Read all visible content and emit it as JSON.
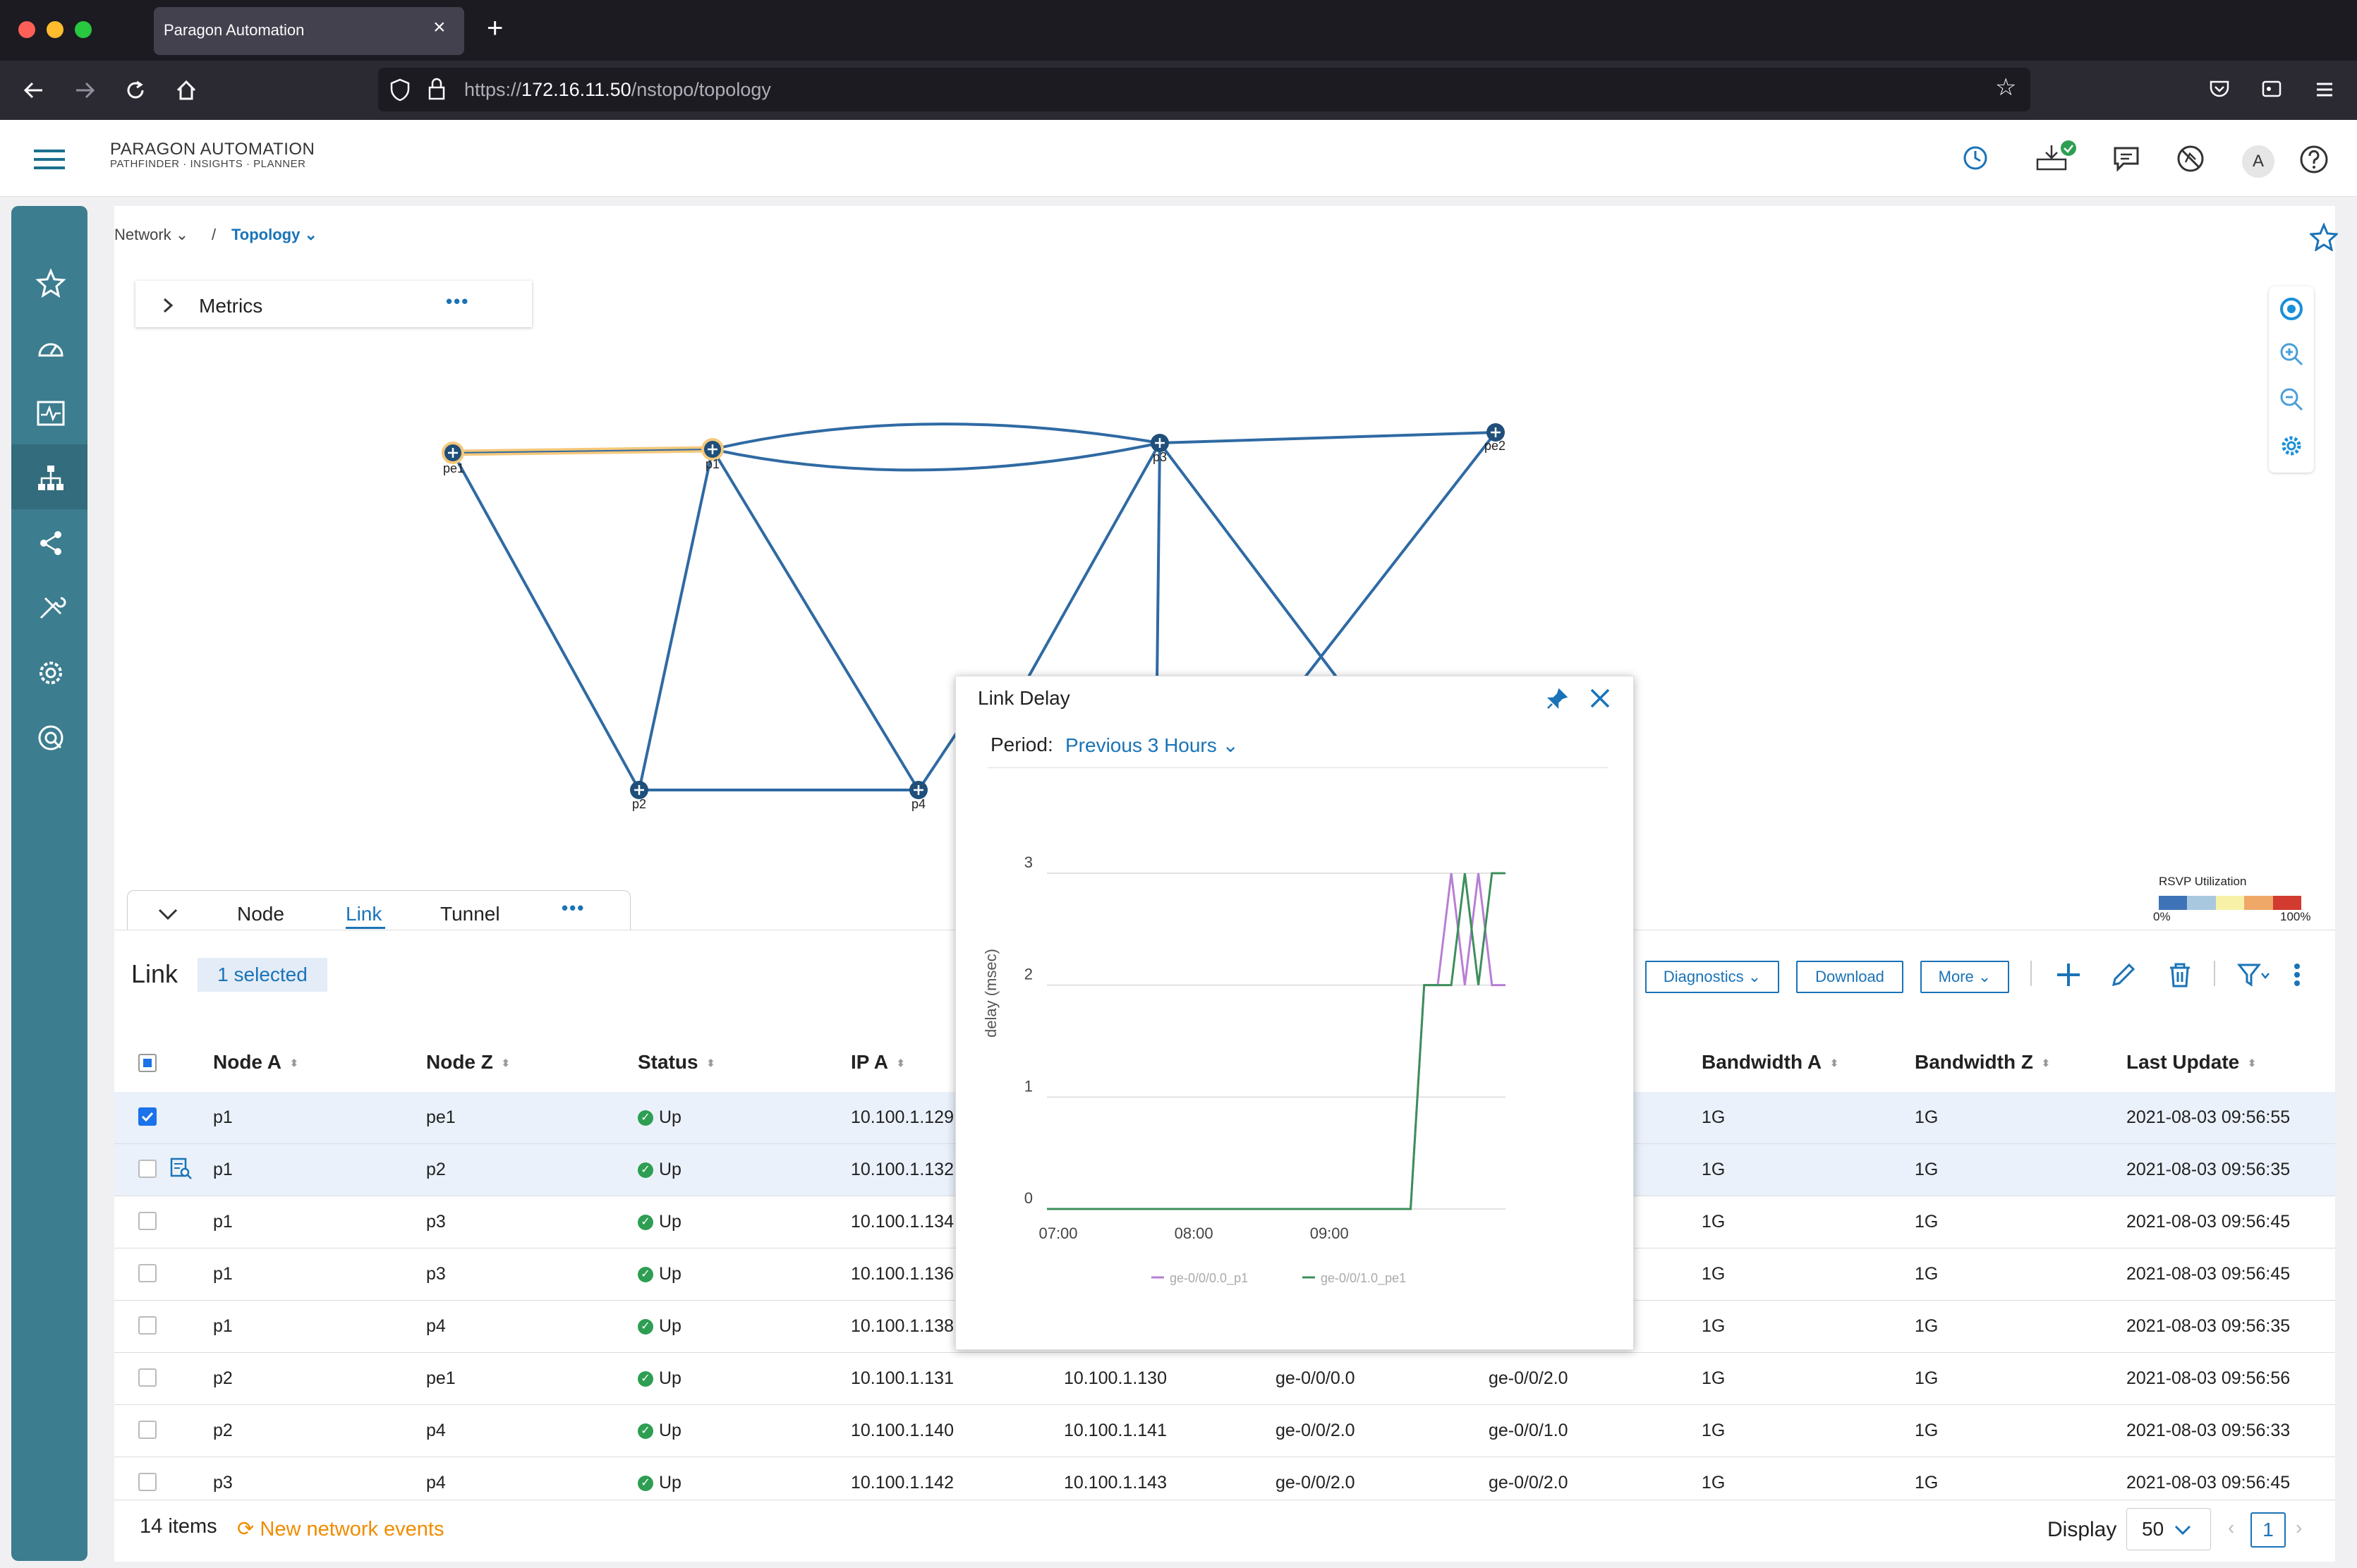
{
  "browser": {
    "tab_title": "Paragon Automation",
    "new_tab": "+",
    "close_tab": "×",
    "url_prefix": "https://",
    "url_host": "172.16.11.50",
    "url_path": "/nstopo/topology"
  },
  "app": {
    "brand_title": "PARAGON AUTOMATION",
    "brand_subtitle": "PATHFINDER · INSIGHTS · PLANNER",
    "avatar_letter": "A"
  },
  "breadcrumb": {
    "network": "Network",
    "separator": "/",
    "topology": "Topology"
  },
  "metrics": {
    "label": "Metrics",
    "more": "•••"
  },
  "topology": {
    "nodes": [
      {
        "id": "pe1",
        "label": "pe1",
        "selected": true
      },
      {
        "id": "p1",
        "label": "p1",
        "selected": true
      },
      {
        "id": "p3",
        "label": "p3",
        "selected": false
      },
      {
        "id": "pe2",
        "label": "pe2",
        "selected": false
      },
      {
        "id": "p2",
        "label": "p2",
        "selected": false
      },
      {
        "id": "p4",
        "label": "p4",
        "selected": false
      }
    ],
    "highlight_color": "#f5c87a",
    "link_color": "#2f6aa3"
  },
  "legend": {
    "title": "RSVP Utilization",
    "min": "0%",
    "max": "100%",
    "colors": [
      "#3e73b7",
      "#a8c8e0",
      "#f7f1a8",
      "#f0a868",
      "#d23b2f"
    ]
  },
  "bottom_tabs": {
    "node": "Node",
    "link": "Link",
    "tunnel": "Tunnel",
    "more": "•••",
    "active": "Link"
  },
  "table": {
    "title": "Link",
    "selected_chip": "1 selected",
    "buttons": {
      "diagnostics": "Diagnostics",
      "download": "Download",
      "more": "More"
    },
    "columns": [
      "Node A",
      "Node Z",
      "Status",
      "IP A",
      "",
      "",
      "",
      "Bandwidth A",
      "Bandwidth Z",
      "Last Update"
    ],
    "rows": [
      {
        "node_a": "p1",
        "node_z": "pe1",
        "status": "Up",
        "ip_a": "10.100.1.129",
        "ip_z": "",
        "if_a": "",
        "if_z": "",
        "bw_a": "1G",
        "bw_z": "1G",
        "last_update": "2021-08-03 09:56:55",
        "checked": true,
        "selected": true
      },
      {
        "node_a": "p1",
        "node_z": "p2",
        "status": "Up",
        "ip_a": "10.100.1.132",
        "ip_z": "",
        "if_a": "",
        "if_z": "",
        "bw_a": "1G",
        "bw_z": "1G",
        "last_update": "2021-08-03 09:56:35",
        "checked": false,
        "selected": true
      },
      {
        "node_a": "p1",
        "node_z": "p3",
        "status": "Up",
        "ip_a": "10.100.1.134",
        "ip_z": "",
        "if_a": "",
        "if_z": "",
        "bw_a": "1G",
        "bw_z": "1G",
        "last_update": "2021-08-03 09:56:45",
        "checked": false,
        "selected": false
      },
      {
        "node_a": "p1",
        "node_z": "p3",
        "status": "Up",
        "ip_a": "10.100.1.136",
        "ip_z": "",
        "if_a": "",
        "if_z": "",
        "bw_a": "1G",
        "bw_z": "1G",
        "last_update": "2021-08-03 09:56:45",
        "checked": false,
        "selected": false
      },
      {
        "node_a": "p1",
        "node_z": "p4",
        "status": "Up",
        "ip_a": "10.100.1.138",
        "ip_z": "",
        "if_a": "",
        "if_z": "",
        "bw_a": "1G",
        "bw_z": "1G",
        "last_update": "2021-08-03 09:56:35",
        "checked": false,
        "selected": false
      },
      {
        "node_a": "p2",
        "node_z": "pe1",
        "status": "Up",
        "ip_a": "10.100.1.131",
        "ip_z": "10.100.1.130",
        "if_a": "ge-0/0/0.0",
        "if_z": "ge-0/0/2.0",
        "bw_a": "1G",
        "bw_z": "1G",
        "last_update": "2021-08-03 09:56:56",
        "checked": false,
        "selected": false
      },
      {
        "node_a": "p2",
        "node_z": "p4",
        "status": "Up",
        "ip_a": "10.100.1.140",
        "ip_z": "10.100.1.141",
        "if_a": "ge-0/0/2.0",
        "if_z": "ge-0/0/1.0",
        "bw_a": "1G",
        "bw_z": "1G",
        "last_update": "2021-08-03 09:56:33",
        "checked": false,
        "selected": false
      },
      {
        "node_a": "p3",
        "node_z": "p4",
        "status": "Up",
        "ip_a": "10.100.1.142",
        "ip_z": "10.100.1.143",
        "if_a": "ge-0/0/2.0",
        "if_z": "ge-0/0/2.0",
        "bw_a": "1G",
        "bw_z": "1G",
        "last_update": "2021-08-03 09:56:45",
        "checked": false,
        "selected": false
      }
    ]
  },
  "footer": {
    "count": "14 items",
    "new_events": "New network events",
    "display_label": "Display",
    "display_value": "50",
    "page": "1",
    "prev": "‹",
    "next": "›"
  },
  "delay_popup": {
    "title": "Link Delay",
    "period_label": "Period:",
    "period_value": "Previous 3 Hours"
  },
  "chart_data": {
    "type": "line",
    "title": "",
    "xlabel": "",
    "ylabel": "delay (msec)",
    "x_ticks": [
      "07:00",
      "08:00",
      "09:00"
    ],
    "y_ticks": [
      "0",
      "1",
      "2",
      "3"
    ],
    "ylim": [
      0,
      3
    ],
    "x": [
      "06:55",
      "07:15",
      "07:35",
      "07:55",
      "08:15",
      "08:35",
      "08:55",
      "09:15",
      "09:30",
      "09:36",
      "09:42",
      "09:48",
      "09:54",
      "10:00",
      "10:06",
      "10:12",
      "10:18"
    ],
    "series": [
      {
        "name": "ge-0/0/0.0_p1",
        "color": "#b77fd6",
        "values": [
          0,
          0,
          0,
          0,
          0,
          0,
          0,
          0,
          0,
          0,
          2,
          2,
          3,
          2,
          3,
          2,
          2
        ]
      },
      {
        "name": "ge-0/0/1.0_pe1",
        "color": "#3d8f5a",
        "values": [
          0,
          0,
          0,
          0,
          0,
          0,
          0,
          0,
          0,
          0,
          2,
          2,
          2,
          3,
          2,
          3,
          3
        ]
      }
    ],
    "grid": true,
    "legend_position": "bottom"
  }
}
